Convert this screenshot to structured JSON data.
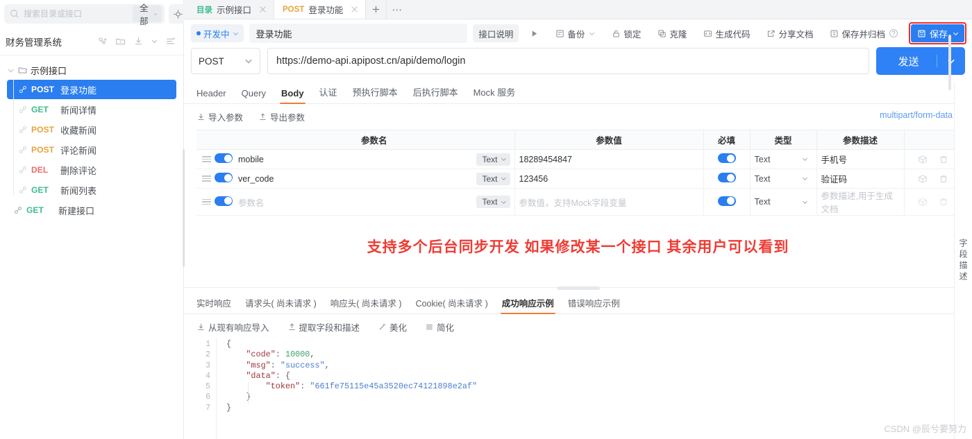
{
  "sidebar": {
    "search": {
      "placeholder": "搜索目录或接口",
      "value": ""
    },
    "filter_label": "全部",
    "project_name": "财务管理系统",
    "icons": [
      "add-member-icon",
      "add-folder-icon",
      "import-icon",
      "filter-icon"
    ],
    "tree": {
      "folder_label": "示例接口",
      "items": [
        {
          "method": "POST",
          "label": "登录功能",
          "selected": true
        },
        {
          "method": "GET",
          "label": "新闻详情",
          "selected": false
        },
        {
          "method": "POST",
          "label": "收藏新闻",
          "selected": false
        },
        {
          "method": "POST",
          "label": "评论新闻",
          "selected": false
        },
        {
          "method": "DEL",
          "label": "删除评论",
          "selected": false
        },
        {
          "method": "GET",
          "label": "新闻列表",
          "selected": false
        }
      ],
      "root_item": {
        "method": "GET",
        "label": "新建接口"
      }
    }
  },
  "tabs": [
    {
      "tag": "目录",
      "title": "示例接口",
      "active": false
    },
    {
      "tag": "POST",
      "title": "登录功能",
      "active": true
    }
  ],
  "tab_actions": {
    "new_tab": "+",
    "more": "⋯"
  },
  "toolbar": {
    "status_label": "开发中",
    "api_name": "登录功能",
    "api_desc_btn": "接口说明",
    "run_icon": "play-icon",
    "backup": "备份",
    "lock": "锁定",
    "clone": "克隆",
    "gen_code": "生成代码",
    "share_doc": "分享文档",
    "save_archive": "保存并归档",
    "save": "保存"
  },
  "request": {
    "method": "POST",
    "url": "https://demo-api.apipost.cn/api/demo/login",
    "send_label": "发送"
  },
  "section_tabs": [
    {
      "label": "Header",
      "active": false
    },
    {
      "label": "Query",
      "active": false
    },
    {
      "label": "Body",
      "active": true
    },
    {
      "label": "认证",
      "active": false
    },
    {
      "label": "预执行脚本",
      "active": false
    },
    {
      "label": "后执行脚本",
      "active": false
    },
    {
      "label": "Mock 服务",
      "active": false
    }
  ],
  "param_actions": {
    "import": "导入参数",
    "export": "导出参数",
    "body_type": "multipart/form-data"
  },
  "params_table": {
    "headers": [
      "参数名",
      "参数值",
      "必填",
      "类型",
      "参数描述"
    ],
    "rows": [
      {
        "name": "mobile",
        "type_chip": "Text",
        "value": "18289454847",
        "required": true,
        "type": "Text",
        "desc": "手机号",
        "placeholder_row": false
      },
      {
        "name": "ver_code",
        "type_chip": "Text",
        "value": "123456",
        "required": true,
        "type": "Text",
        "desc": "验证码",
        "placeholder_row": false
      },
      {
        "name": "参数名",
        "type_chip": "Text",
        "value": "参数值，支持Mock字段变量",
        "required": true,
        "type": "Text",
        "desc": "参数描述,用于生成文档",
        "placeholder_row": true
      }
    ]
  },
  "annotation": {
    "text": "支持多个后台同步开发  如果修改某一个接口 其余用户可以看到",
    "color": "#ef3b33"
  },
  "response_tabs": [
    {
      "label": "实时响应",
      "active": false
    },
    {
      "label": "请求头( 尚未请求 )",
      "active": false
    },
    {
      "label": "响应头( 尚未请求 )",
      "active": false
    },
    {
      "label": "Cookie( 尚未请求 )",
      "active": false
    },
    {
      "label": "成功响应示例",
      "active": true
    },
    {
      "label": "错误响应示例",
      "active": false
    }
  ],
  "response_actions": [
    {
      "label": "从现有响应导入",
      "icon": "import-icon"
    },
    {
      "label": "提取字段和描述",
      "icon": "export-icon"
    },
    {
      "label": "美化",
      "icon": "beautify-icon"
    },
    {
      "label": "简化",
      "icon": "simplify-icon"
    }
  ],
  "code": {
    "line_numbers": [
      "1",
      "2",
      "3",
      "4",
      "5",
      "6",
      "7"
    ],
    "lines": [
      "{",
      "    \"code\": 10000,",
      "    \"msg\": \"success\",",
      "    \"data\": {",
      "        \"token\": \"661fe75115e45a3520ec74121898e2af\"",
      "    }",
      "}"
    ],
    "token_value": "661fe75115e45a3520ec74121898e2af",
    "code_value": "10000",
    "msg_value": "success"
  },
  "right_rail": {
    "label": "字段描述"
  },
  "watermark": "CSDN @辰兮要努力",
  "colors": {
    "accent": "#2a7ef0",
    "post": "#e8a33d",
    "get": "#3bbd8d",
    "del": "#f06a6a",
    "annotation_red": "#ef3b33",
    "tab_underline": "#ef7d36"
  }
}
